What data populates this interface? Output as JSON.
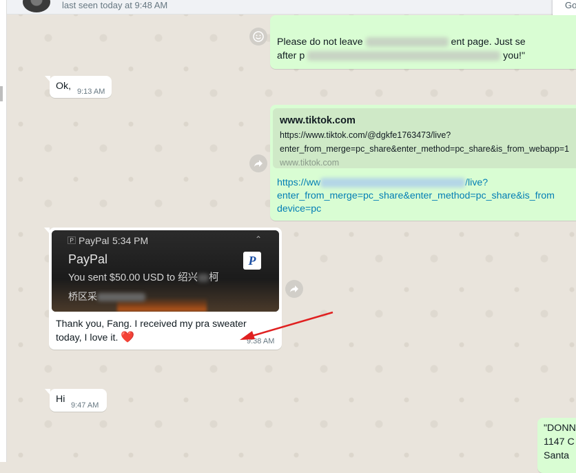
{
  "header": {
    "status": "last seen today at 9:48 AM",
    "go_button": "Go"
  },
  "messages": {
    "m1": {
      "line1_pre": "Please do not leave",
      "line1_post": "ent page. Just se",
      "line2_pre": "after p",
      "line2_post": "you!\""
    },
    "ok": {
      "text": "Ok,",
      "time": "9:13 AM"
    },
    "link_msg": {
      "preview_title": "www.tiktok.com",
      "preview_url_1": "https://www.tiktok.com/@dgkfe1763473/live?",
      "preview_url_2": "enter_from_merge=pc_share&enter_method=pc_share&is_from_webapp=1",
      "preview_domain": "www.tiktok.com",
      "link_1_pre": "https://ww",
      "link_1_post": "/live?",
      "link_2": "enter_from_merge=pc_share&enter_method=pc_share&is_from",
      "link_3": "device=pc"
    },
    "paypal_msg": {
      "notif_app": "PayPal",
      "notif_time": "5:34 PM",
      "notif_title": "PayPal",
      "notif_body": "You sent $50.00 USD  to 绍兴",
      "notif_body_2": "柯",
      "notif_line3": "桥区采",
      "caption_1": "Thank you, Fang. I received my pra sweater",
      "caption_2": "today, I love it.",
      "heart": "❤️",
      "time": "9:38 AM"
    },
    "hi": {
      "text": "Hi",
      "time": "9:47 AM"
    },
    "address": {
      "line1": "\"DONN",
      "line2": "1147 C",
      "line3": "Santa"
    }
  },
  "icons": {
    "emoji": "smiley-icon",
    "forward": "forward-icon",
    "paypal_logo": "P"
  },
  "colors": {
    "incoming_bubble": "#ffffff",
    "outgoing_bubble": "#d9fdd3",
    "link": "#027eb5",
    "arrow": "#e02020"
  }
}
